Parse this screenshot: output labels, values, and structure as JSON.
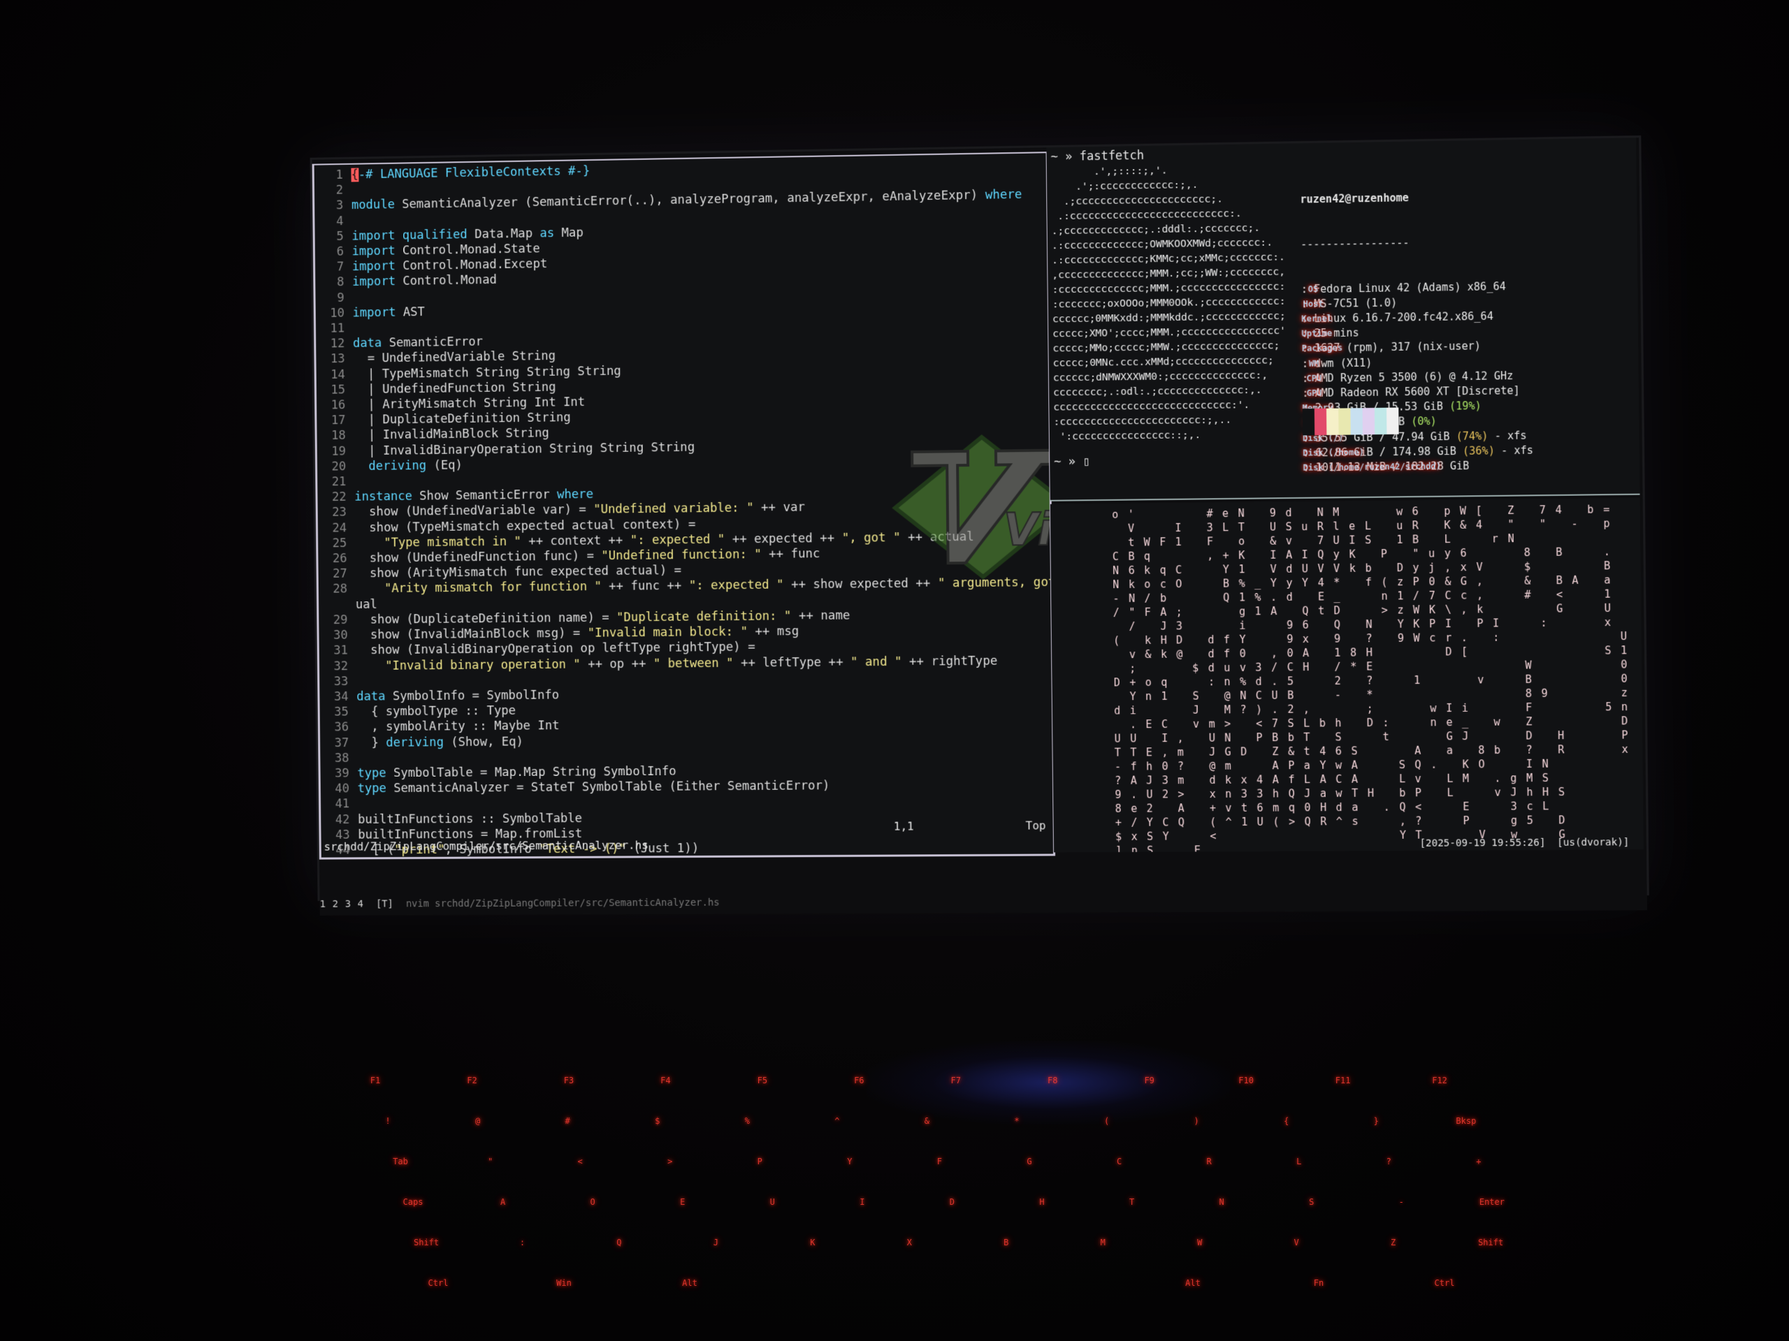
{
  "vim": {
    "lines": [
      {
        "n": "1",
        "html": "<span class=\"cur\">{</span><span class=\"pragma\">-# LANGUAGE FlexibleContexts #-}</span>"
      },
      {
        "n": "2",
        "html": ""
      },
      {
        "n": "3",
        "html": "<span class=\"kw\">module</span> SemanticAnalyzer (SemanticError(..), analyzeProgram, analyzeExpr, eAnalyzeExpr) <span class=\"kw\">where</span>"
      },
      {
        "n": "4",
        "html": ""
      },
      {
        "n": "5",
        "html": "<span class=\"kw\">import</span> <span class=\"kw\">qualified</span> Data.Map <span class=\"kw\">as</span> Map"
      },
      {
        "n": "6",
        "html": "<span class=\"kw\">import</span> Control.Monad.State"
      },
      {
        "n": "7",
        "html": "<span class=\"kw\">import</span> Control.Monad.Except"
      },
      {
        "n": "8",
        "html": "<span class=\"kw\">import</span> Control.Monad"
      },
      {
        "n": "9",
        "html": ""
      },
      {
        "n": "10",
        "html": "<span class=\"kw\">import</span> AST"
      },
      {
        "n": "11",
        "html": ""
      },
      {
        "n": "12",
        "html": "<span class=\"kw\">data</span> SemanticError"
      },
      {
        "n": "13",
        "html": "  = UndefinedVariable String"
      },
      {
        "n": "14",
        "html": "  | TypeMismatch String String String"
      },
      {
        "n": "15",
        "html": "  | UndefinedFunction String"
      },
      {
        "n": "16",
        "html": "  | ArityMismatch String Int Int"
      },
      {
        "n": "17",
        "html": "  | DuplicateDefinition String"
      },
      {
        "n": "18",
        "html": "  | InvalidMainBlock String"
      },
      {
        "n": "19",
        "html": "  | InvalidBinaryOperation String String String"
      },
      {
        "n": "20",
        "html": "  <span class=\"kw\">deriving</span> (Eq)"
      },
      {
        "n": "21",
        "html": ""
      },
      {
        "n": "22",
        "html": "<span class=\"kw\">instance</span> Show SemanticError <span class=\"kw\">where</span>"
      },
      {
        "n": "23",
        "html": "  show (UndefinedVariable var) = <span class=\"str\">\"Undefined variable: \"</span> ++ var"
      },
      {
        "n": "24",
        "html": "  show (TypeMismatch expected actual context) ="
      },
      {
        "n": "25",
        "html": "    <span class=\"str\">\"Type mismatch in \"</span> ++ context ++ <span class=\"str\">\": expected \"</span> ++ expected ++ <span class=\"str\">\", got \"</span> ++ actual"
      },
      {
        "n": "26",
        "html": "  show (UndefinedFunction func) = <span class=\"str\">\"Undefined function: \"</span> ++ func"
      },
      {
        "n": "27",
        "html": "  show (ArityMismatch func expected actual) ="
      },
      {
        "n": "28",
        "html": "    <span class=\"str\">\"Arity mismatch for function \"</span> ++ func ++ <span class=\"str\">\": expected \"</span> ++ show expected ++ <span class=\"str\">\" arguments, got \"</span> ++ show act"
      },
      {
        "n": "",
        "html": "ual"
      },
      {
        "n": "29",
        "html": "  show (DuplicateDefinition name) = <span class=\"str\">\"Duplicate definition: \"</span> ++ name"
      },
      {
        "n": "30",
        "html": "  show (InvalidMainBlock msg) = <span class=\"str\">\"Invalid main block: \"</span> ++ msg"
      },
      {
        "n": "31",
        "html": "  show (InvalidBinaryOperation op leftType rightType) ="
      },
      {
        "n": "32",
        "html": "    <span class=\"str\">\"Invalid binary operation \"</span> ++ op ++ <span class=\"str\">\" between \"</span> ++ leftType ++ <span class=\"str\">\" and \"</span> ++ rightType"
      },
      {
        "n": "33",
        "html": ""
      },
      {
        "n": "34",
        "html": "<span class=\"kw\">data</span> SymbolInfo = SymbolInfo"
      },
      {
        "n": "35",
        "html": "  { symbolType :: Type"
      },
      {
        "n": "36",
        "html": "  , symbolArity :: Maybe Int"
      },
      {
        "n": "37",
        "html": "  } <span class=\"kw\">deriving</span> (Show, Eq)"
      },
      {
        "n": "38",
        "html": ""
      },
      {
        "n": "39",
        "html": "<span class=\"kw\">type</span> SymbolTable = Map.Map String SymbolInfo"
      },
      {
        "n": "40",
        "html": "<span class=\"kw\">type</span> SemanticAnalyzer = StateT SymbolTable (Either SemanticError)"
      },
      {
        "n": "41",
        "html": ""
      },
      {
        "n": "42",
        "html": "builtInFunctions :: SymbolTable"
      },
      {
        "n": "43",
        "html": "builtInFunctions = Map.fromList"
      },
      {
        "n": "44",
        "html": "  [ (<span class=\"str\">\"print\"</span>, SymbolInfo <span class=\"str\">\"Text -&gt; ()\"</span> (Just 1))"
      }
    ],
    "cursor_pos": "1,1",
    "scroll_pos": "Top",
    "file_path": "srchdd/ZipZipLangCompiler/src/SemanticAnalyzer.hs",
    "logo_text": "Vim"
  },
  "fastfetch": {
    "command": "~ » fastfetch",
    "art": "       .',;::::;,'.\n    .';:cccccccccccc:;,.\n  .;cccccccccccccccccccccc;.\n .:cccccccccccccccccccccccccc:.\n.;ccccccccccccc;.:dddl:.;ccccccc;.\n.:ccccccccccccc;OWMKOOXMWd;ccccccc:.\n.:ccccccccccccc;KMMc;cc;xMMc;ccccccc:.\n,cccccccccccccc;MMM.;cc;;WW:;cccccccc,\n:cccccccccccccc;MMM.;cccccccccccccccc:\n:ccccccc;oxOOOo;MMM0OOk.;cccccccccccc:\ncccccc;0MMKxdd:;MMMkddc.;cccccccccccc;\nccccc;XMO';cccc;MMM.;cccccccccccccccc'\nccccc;MMo;ccccc;MMW.;ccccccccccccccc;\nccccc;0MNc.ccc.xMMd;ccccccccccccccc;\ncccccc;dNMWXXXWM0:;cccccccccccccc:,\ncccccccc;.:odl:.;cccccccccccccc:,.\nccccccccccccccccccccccccccccc:'.\n:ccccccccccccccccccccccc:;,..\n ':cccccccccccccccc::;,.",
    "user_host": "ruzen42@ruzenhome",
    "separator": "-----------------",
    "info": [
      {
        "key": "OS",
        "value": "Fedora Linux 42 (Adams) x86_64"
      },
      {
        "key": "Host",
        "value": "MS-7C51 (1.0)"
      },
      {
        "key": "Kernel",
        "value": "Linux 6.16.7-200.fc42.x86_64"
      },
      {
        "key": "Uptime",
        "value": "25 mins"
      },
      {
        "key": "Packages",
        "value": "1637 (rpm), 317 (nix-user)"
      },
      {
        "key": "WM",
        "value": "dwm (X11)"
      },
      {
        "key": "CPU",
        "value": "AMD Ryzen 5 3500 (6) @ 4.12 GHz"
      },
      {
        "key": "GPU",
        "value": "AMD Radeon RX 5600 XT [Discrete]"
      },
      {
        "key": "Memory",
        "value": "2.93 GiB / 15.53 GiB",
        "pct": "(19%)",
        "pct_class": "pct-ok"
      },
      {
        "key": "Swap",
        "value": "0 B / 8.00 GiB",
        "pct": "(0%)",
        "pct_class": "pct-ok"
      },
      {
        "key": "Disk (/)",
        "value": "35.55 GiB / 47.94 GiB",
        "pct": "(74%)",
        "pct_class": "pct-warn",
        "suffix": "- xfs"
      },
      {
        "key": "Disk (/home)",
        "value": "62.86 GiB / 174.98 GiB",
        "pct": "(36%)",
        "pct_class": "pct-warn",
        "suffix": "- xfs"
      },
      {
        "key": "Disk (/home/ruzen42/srchdd)",
        "value": "1011.13 MiB / 182.28 GiB",
        "pct": "",
        "pct_class": "",
        "suffix": ""
      }
    ],
    "palette": [
      "#111214",
      "#e24a6a",
      "#f5f0c8",
      "#e8e8b0",
      "#c8e0f0",
      "#e0d0f0",
      "#c0e8e8",
      "#f0f0f0"
    ],
    "prompt": "~ » ▯"
  },
  "matrix": {
    "columns": [
      "o\n\n\nC\nN\nN\n-\n/\n\n(\n\n\nD\n\nd\n\nU\nT\n-\n?\n9\n8\n+\n$\n]\n\"",
      "'\nV\nt\nB\n6\nk\nN\n\"\n/\n\nv\n;\n+\nY\ni\n.\nU\nT\nf\nA\n.\ne\n/\nx\nn\n#",
      "\n\nW\nq\nk\no\n/\nF\n\nk\n&\n\no\nn\n\nE\n\nE\nh\nJ\nU\n2\nY\nS\nS",
      "\n\nF\n\nq\nc\nb\nA\nJ\nH\nk\n\nq\n1\n\nC\nI\n,\n0\n3\n2\n\nC\nY\n",
      "\nI\n1\n\nC\nO\n\n;\n3\nD\n@\n\n\n\n\n\n,\nm\n?\nm\n>\nA\nQ\n",
      "\n\n\n\n\n\n\n\n\n\n\n$\n\nS\nJ\nv\n\n\n\n\n\n\n\n\nE",
      "#\n3\nF\n,\n\n\n\n\n\nd\nd\nd\n:\n\n\nm\nU\nJ\n@\nd\nx\n+\n(\n<",
      "e\nL\n\n+\nY\nB\nQ\n\n\nf\nf\nu\nn\n@\nM\n>\nN\nG\nm\nk\nn\nv\n^",
      "N\nT\no\nK\n1\n%\n1\ng\ni\nY\n0\nv\n%\nN\n?\n\n\nD\n\nx\n3\nt\n1",
      "\n\n\n\n\n_\n%\n1\n\n\n\n3\nd\nC\n)\n<\nP\n\n\n4\n3\n6\nU",
      "9\nU\n&\nI\nV\nY\n.\nA\n\n\n,\n/\n.\nU\n.\n7\nB\nZ\nA\nA\nh\nm\n(",
      "d\nS\nv\nA\nd\ny\nd\n\n9\n9\n0\nC\n5\nB\n2\nS\nb\n&\nP\nf\nQ\nq\n>",
      "\nu\n\nI\nU\nY\n\nQ\n6\nx\nA\nH\n\n\n,\nL\nT\nt\na\nL\nJ\n0\nQ",
      "N\nR\n7\nQ\nV\n4\nE\nt\n\n\n\n\n\n\n\nb\n\n4\nY\nA\na\nH\nR",
      "M\nl\nU\ny\nV\n*\n_\nD\nQ\n9\n1\n/\n2\n-\n\nh\nS\n6\nw\nC\nw\nd\n^",
      "\ne\nI\nK\nk\n\n\n\n\n\n8\n*\n\n\n\n\n\nS\nA\nA\nT\na\ns",
      "\nL\nS\n\nb\nf\n\n\nN\n?\nH\nE\n?\n*\n;\nD\n\n\n\n\nH\n\n\n\n",
      "\n\n\nP\n\n(\nn\n>\n\n\n\n\n\n\n\n:\nt\n\n\n\n\n.\n",
      "w\nu\n1\n\nD\nz\n1\nz\nY\n9\n\n\n\n\n\n\n\n\nS\nL\nb\nQ\n,\nY",
      "6\nR\nB\n\"\ny\nP\n/\nW\nK\nW\n\n\n1\n\n\n\n\nA\nQ\nv\nP\n<\n?\nT",
      "\n\n\nu\nj\n0\n7\nK\nP\nc\n\n\n\n\nw\nn\n\n\n.\n\n\n\n\n",
      "p\nK\nL\ny\n,\n&\nC\n\\\nI\nr\nD\n\n\n\nI\ne\nG\na\n\nL\nL\n\n",
      "W\n&\n\n6\nx\nG\nc\n,\n\n.\n[\n\n\n\ni\n_\nJ\n\nK\nM\n\nE\nP",
      "[\n4\n\n\nV\n,\n,\nk\nP\n\n\n\nv\n\n\n\n\n8\nO\n\n\n\n\nV",
      "\n\nr\n\n\n\n\n\nI\n:\n\n\n\n\n\nw\n\nb\n\n.\nv\n\n\n\n",
      "Z\n\"\nN\n\n\n\n\n\n\n\n\n\n\n\n\n\n\n\n\ng\nJ\n3\ng\nw",
      "\n\n\n8\n$\n&\n#\n\n\n\n\nW\nB\n8\nF\nZ\nD\n?\nI\nM\nh\nc\n5\n\n",
      "7\n\"\n\n\n\n\n\n\n:\n\n\n\n\n9\n\n\n\n\nN\nS\nH\nL\n\n\n",
      "4\n\n\nB\n\nB\n<\nG\n\n\n\n\n\n\n\n\nH\nR\n\n\nS\n\nD\nG",
      "\n-\n\n\n\nA\n\n\n\n\n\n\n\n\n\n\n\n\n\n\n\n\n\n",
      "b\n\n\n\n\n\n\n\n\n\n\n\n\n\n\n\n\n\n\n\n\n\n",
      "=\np\n\n.\nB\na\n1\nU\nx\n\nS\n\n\n\n5\n\n\n\n\n\n",
      "\n\n\n\n\n\n\n\n\nU\n1\n0\n0\nz\nn\nD\nP\nx\n\n\n"
    ],
    "datetime": "[2025-09-19 19:55:26]",
    "layout": "[us(dvorak)]"
  },
  "dwm": {
    "tags": [
      "1",
      "2",
      "3",
      "4"
    ],
    "layout_symbol": "[T]",
    "title": "nvim srchdd/ZipZipLangCompiler/src/SemanticAnalyzer.hs"
  },
  "keyboard": {
    "rows": [
      [
        "F1",
        "F2",
        "F3",
        "F4",
        "F5",
        "F6",
        "F7",
        "F8",
        "F9",
        "F10",
        "F11",
        "F12"
      ],
      [
        "!",
        "@",
        "#",
        "$",
        "%",
        "^",
        "&",
        "*",
        "(",
        ")",
        "{",
        "}",
        "Bksp"
      ],
      [
        "Tab",
        "\"",
        "<",
        ">",
        "P",
        "Y",
        "F",
        "G",
        "C",
        "R",
        "L",
        "?",
        "+"
      ],
      [
        "Caps",
        "A",
        "O",
        "E",
        "U",
        "I",
        "D",
        "H",
        "T",
        "N",
        "S",
        "-",
        "Enter"
      ],
      [
        "Shift",
        ":",
        "Q",
        "J",
        "K",
        "X",
        "B",
        "M",
        "W",
        "V",
        "Z",
        "Shift"
      ],
      [
        "Ctrl",
        "Win",
        "Alt",
        "",
        "",
        "",
        "Alt",
        "Fn",
        "Ctrl"
      ]
    ]
  }
}
